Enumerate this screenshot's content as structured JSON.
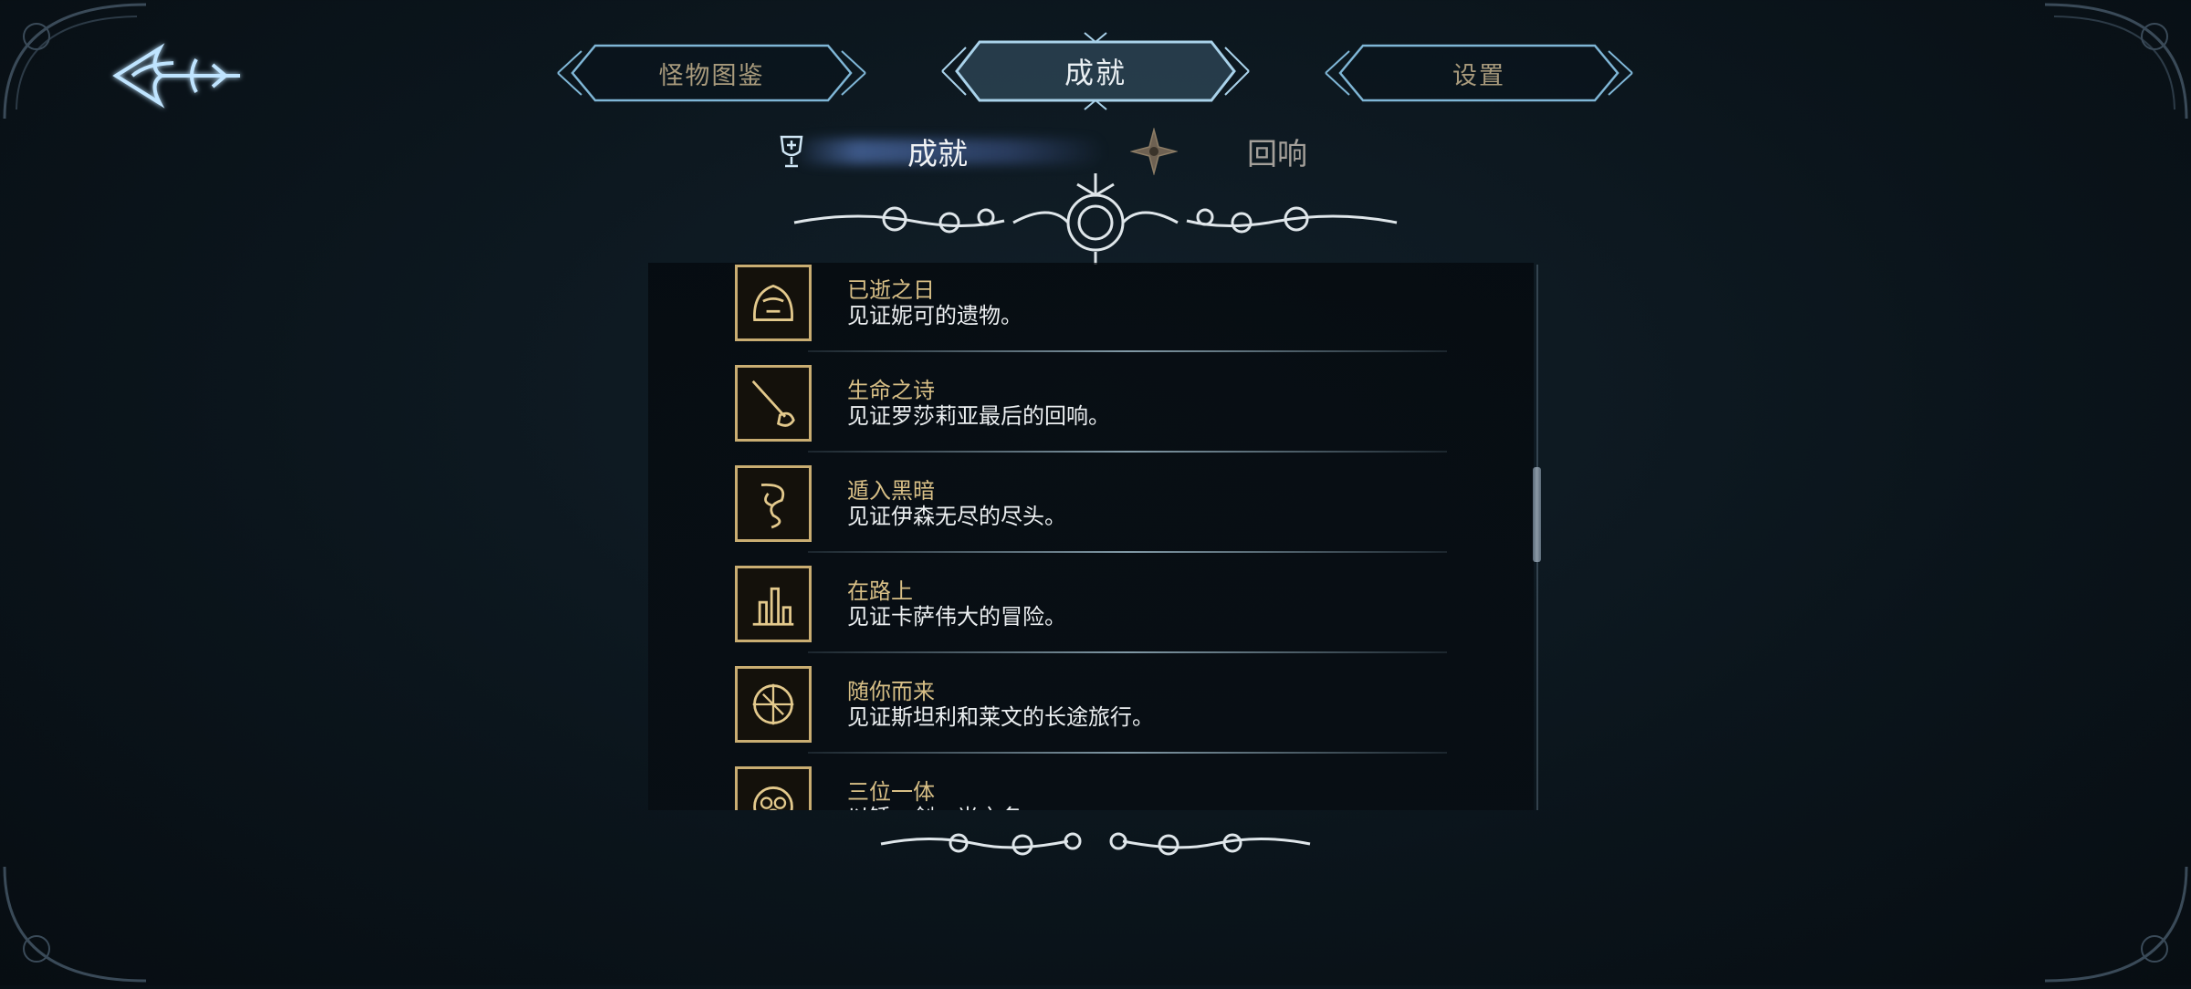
{
  "nav": {
    "tabs": [
      {
        "label": "怪物图鉴"
      },
      {
        "label": "成就"
      },
      {
        "label": "设置"
      }
    ],
    "active_tab": "成就"
  },
  "subnav": {
    "tabs": [
      {
        "label": "成就",
        "icon": "trophy-icon"
      },
      {
        "label": "回响",
        "icon": "star-emblem-icon"
      }
    ],
    "active_subtab": "成就"
  },
  "achievements": [
    {
      "title": "已逝之日",
      "desc": "见证妮可的遗物。",
      "icon": "bell-emblem-icon"
    },
    {
      "title": "生命之诗",
      "desc": "见证罗莎莉亚最后的回响。",
      "icon": "flute-emblem-icon"
    },
    {
      "title": "遁入黑暗",
      "desc": "见证伊森无尽的尽头。",
      "icon": "spiral-emblem-icon"
    },
    {
      "title": "在路上",
      "desc": "见证卡萨伟大的冒险。",
      "icon": "castle-emblem-icon"
    },
    {
      "title": "随你而来",
      "desc": "见证斯坦利和莱文的长途旅行。",
      "icon": "compass-emblem-icon"
    },
    {
      "title": "三位一体",
      "desc": "以锤、剑、光之名",
      "icon": "triad-emblem-icon"
    }
  ],
  "colors": {
    "accent_gold": "#d8bf86",
    "frame_blue": "#7fb6d6",
    "text_white": "#eceff1"
  }
}
